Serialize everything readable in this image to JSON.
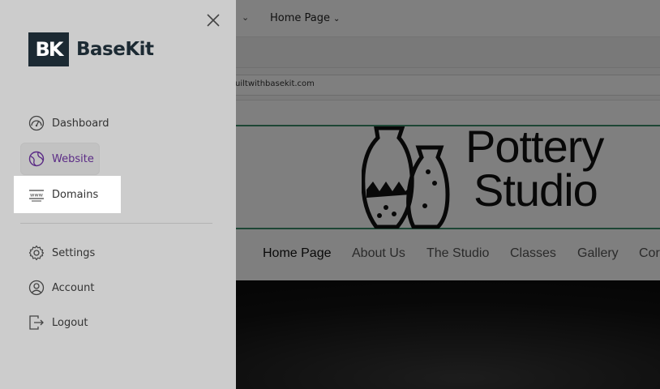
{
  "background": {
    "topnav": {
      "home_label": "Home Page"
    },
    "url_text": "uiltwithbasekit.com",
    "logo": {
      "line1": "Pottery",
      "line2": "Studio"
    },
    "site_nav": [
      "Home Page",
      "About Us",
      "The Studio",
      "Classes",
      "Gallery",
      "Cor"
    ]
  },
  "sidebar": {
    "brand_mark": "BK",
    "brand_name": "BaseKit",
    "items": [
      {
        "label": "Dashboard",
        "icon": "dashboard-gauge-icon"
      },
      {
        "label": "Website",
        "icon": "globe-icon"
      },
      {
        "label": "Domains",
        "icon": "www-icon"
      },
      {
        "label": "Settings",
        "icon": "gear-icon"
      },
      {
        "label": "Account",
        "icon": "user-circle-icon"
      },
      {
        "label": "Logout",
        "icon": "logout-icon"
      }
    ]
  },
  "colors": {
    "brand_dark": "#1c2a33",
    "website_active": "#5b2b86",
    "hero_border": "#3b8c6a",
    "sidebar_bg": "#cccccc"
  }
}
